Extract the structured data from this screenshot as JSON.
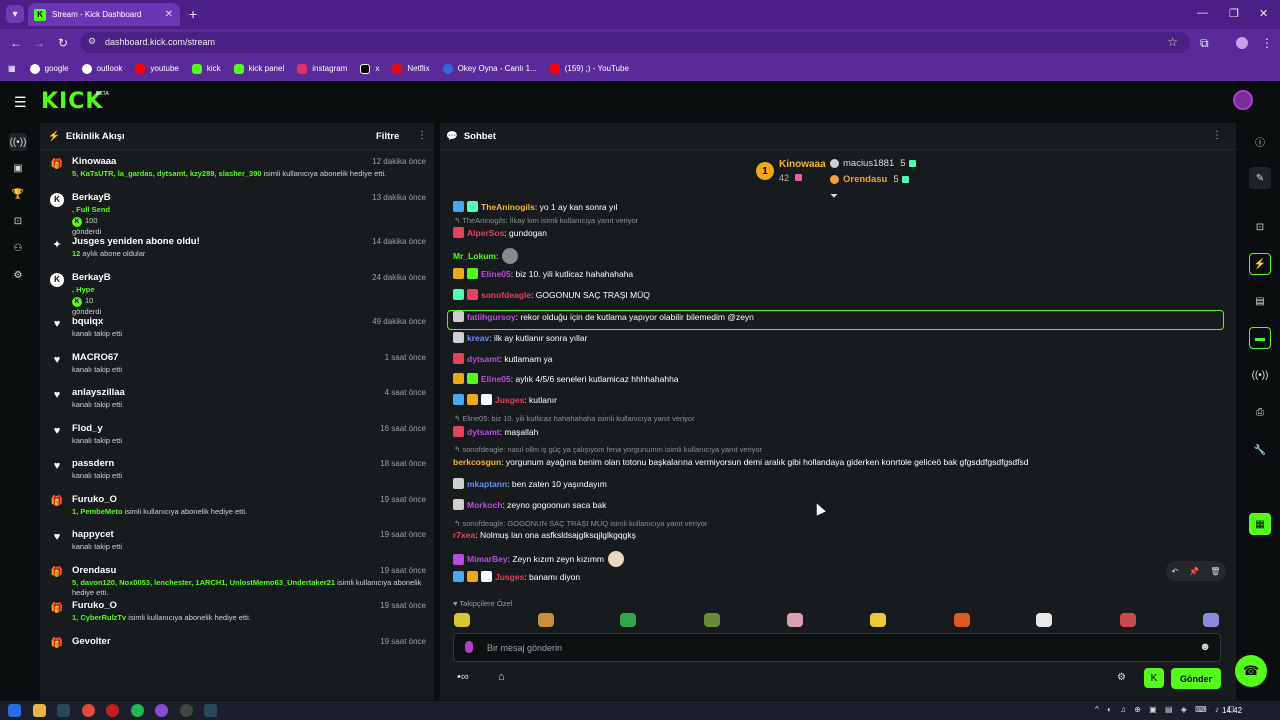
{
  "browser": {
    "tab_title": "Stream - Kick Dashboard",
    "url": "dashboard.kick.com/stream",
    "bookmarks": [
      {
        "label": "google",
        "color": "#ffffff"
      },
      {
        "label": "outlook",
        "color": "#ffffff"
      },
      {
        "label": "youtube",
        "color": "#ff0000"
      },
      {
        "label": "kick",
        "color": "#53fc18"
      },
      {
        "label": "kick panel",
        "color": "#53fc18"
      },
      {
        "label": "instagram",
        "color": "#e1306c"
      },
      {
        "label": "x",
        "color": "#ffffff"
      },
      {
        "label": "Netflix",
        "color": "#e50914"
      },
      {
        "label": "Okey Oyna - Canlı 1...",
        "color": "#2d6cdf"
      },
      {
        "label": "(159) ;) - YouTube",
        "color": "#ff0000"
      }
    ]
  },
  "header": {
    "logo": "KICK",
    "logo_badge": "BETA"
  },
  "activity": {
    "title": "Etkinlik Akışı",
    "filter_label": "Filtre",
    "items": [
      {
        "icon": "gift-icon",
        "name": "Kinowaaa",
        "time": "12 dakika önce",
        "highlight": "5, KaTsUTR, la_gardas, dytsamt, kzy289, slasher_390",
        "text": " isimli kullanıcıya abonelik hediye etti."
      },
      {
        "icon": "kick-coin-icon",
        "name": "BerkayB",
        "time": "13 dakika önce",
        "highlight": ", Full Send",
        "amount": "100",
        "text": "gönderdi"
      },
      {
        "icon": "sparkle-icon",
        "name": "Jusges yeniden abone oldu!",
        "time": "14 dakika önce",
        "highlight": "12",
        "text": " aylık abone oldular"
      },
      {
        "icon": "kick-coin-icon",
        "name": "BerkayB",
        "time": "24 dakika önce",
        "highlight": ", Hype",
        "amount": "10",
        "text": "gönderdi"
      },
      {
        "icon": "heart-icon",
        "name": "bquiqx",
        "time": "49 dakika önce",
        "text": "kanalı takip etti"
      },
      {
        "icon": "heart-icon",
        "name": "MACRO67",
        "time": "1 saat önce",
        "text": "kanalı takip etti"
      },
      {
        "icon": "heart-icon",
        "name": "anlayszillaa",
        "time": "4 saat önce",
        "text": "kanalı takip etti"
      },
      {
        "icon": "heart-icon",
        "name": "Flod_y",
        "time": "16 saat önce",
        "text": "kanalı takip etti"
      },
      {
        "icon": "heart-icon",
        "name": "passdern",
        "time": "18 saat önce",
        "text": "kanalı takip etti"
      },
      {
        "icon": "gift-icon",
        "name": "Furuko_O",
        "time": "19 saat önce",
        "highlight": "1, PembeMeto",
        "text": " isimli kullanıcıya abonelik hediye etti."
      },
      {
        "icon": "heart-icon",
        "name": "happycet",
        "time": "19 saat önce",
        "text": "kanalı takip etti"
      },
      {
        "icon": "gift-icon",
        "name": "Orendasu",
        "time": "19 saat önce",
        "highlight": "5, davon120, Nox0053, lenchester, 1ARCH1, UnlostMemo63_Undertaker21",
        "text": " isimli kullanıcıya abonelik hediye etti."
      },
      {
        "icon": "gift-icon",
        "name": "Furuko_O",
        "time": "19 saat önce",
        "highlight": "1, CyberRulzTv",
        "text": " isimli kullanıcıya abonelik hediye etti."
      },
      {
        "icon": "gift-icon",
        "name": "Gevolter",
        "time": "19 saat önce",
        "text": ""
      }
    ]
  },
  "chat": {
    "title": "Sohbet",
    "leaderboard": {
      "top_rank": "1",
      "top_name": "Kinowaaa",
      "top_count": "42",
      "others": [
        {
          "name": "macius1881",
          "count": "5",
          "color": "#cfcfcf"
        },
        {
          "name": "Orendasu",
          "count": "5",
          "color": "#f6a03b"
        }
      ]
    },
    "messages": [
      {
        "user": "TheAninogils",
        "color": "#f6b632",
        "text": ": yo 1 ay kan sonra yıl"
      },
      {
        "reply": "TheAninogils: İlkay kim isimli kullanıcıya yanıt veriyor"
      },
      {
        "user": "AlperSos",
        "color": "#e2445c",
        "text": ": gundogan"
      },
      {
        "user": "Mr_Lokum",
        "color": "#53fc18",
        "text": ":"
      },
      {
        "user": "Eline05",
        "color": "#b84ee0",
        "text": ": biz 10. yili kutlicaz hahahahaha"
      },
      {
        "user": "sonofdeagle",
        "color": "#e2445c",
        "text": ": GOGONUN SAÇ TRAŞI MÜQ"
      },
      {
        "user": "fatiihgursoy",
        "color": "#b84ee0",
        "text": ": rekor olduğu için de kutlama yapıyor olabilir bilemedim @zeyn"
      },
      {
        "user": "kreav",
        "color": "#6a8cff",
        "text": ": ilk ay kutlanır sonra yıllar"
      },
      {
        "user": "dytsamt",
        "color": "#b84ee0",
        "text": ": kutlamam ya"
      },
      {
        "user": "Eline05",
        "color": "#b84ee0",
        "text": ": aylık 4/5/6 seneleri kutlamicaz hhhhahahha"
      },
      {
        "user": "Jusges",
        "color": "#e2445c",
        "text": ": kutlanır"
      },
      {
        "reply": "Eline05: biz 10. yili kutlicaz hahahahaha isimli kullanıcıya yanıt veriyor"
      },
      {
        "user": "dytsamt",
        "color": "#b84ee0",
        "text": ": maşallah"
      },
      {
        "reply": "sonofdeagle: nasıl ollm iş güç ya çalışıyom fena yorgunumm isimli kullanıcıya yanıt veriyor"
      },
      {
        "user": "berkcosgun",
        "color": "#f6b632",
        "text": ": yorgunum ayağına benim olan totonu başkalarına vermiyorsun demi aralık gibi hollandaya giderken konrtole geliceö bak gfgsddfgsdfgsdfsd"
      },
      {
        "user": "mkaptann",
        "color": "#6a8cff",
        "text": ": ben zaten 10 yaşındayım"
      },
      {
        "user": "Morkoch",
        "color": "#b84ee0",
        "text": ": zeyno gogoonun saca bak"
      },
      {
        "reply": "sonofdeagle: GOGONUN SAÇ TRAŞI MÜQ isimli kullanıcıya yanıt veriyor"
      },
      {
        "user": "r7xea",
        "color": "#e2445c",
        "text": ": Nolmuş lan ona asfksldsajglksqjlglkgqgkş"
      },
      {
        "user": "MimarBey",
        "color": "#b84ee0",
        "text": ": Zeyn kızım zeyn kızımm"
      },
      {
        "user": "Jusges",
        "color": "#e2445c",
        "text": ": banamı diyon"
      }
    ],
    "emote_section_label": "Takipçilere Özel",
    "input_placeholder": "Bir mesaj gönderin",
    "send_label": "Gönder"
  },
  "taskbar": {
    "time": "14:42"
  },
  "colors": {
    "accent": "#53fc18",
    "panel": "#181b1d",
    "browser": "#5a2a9a"
  }
}
